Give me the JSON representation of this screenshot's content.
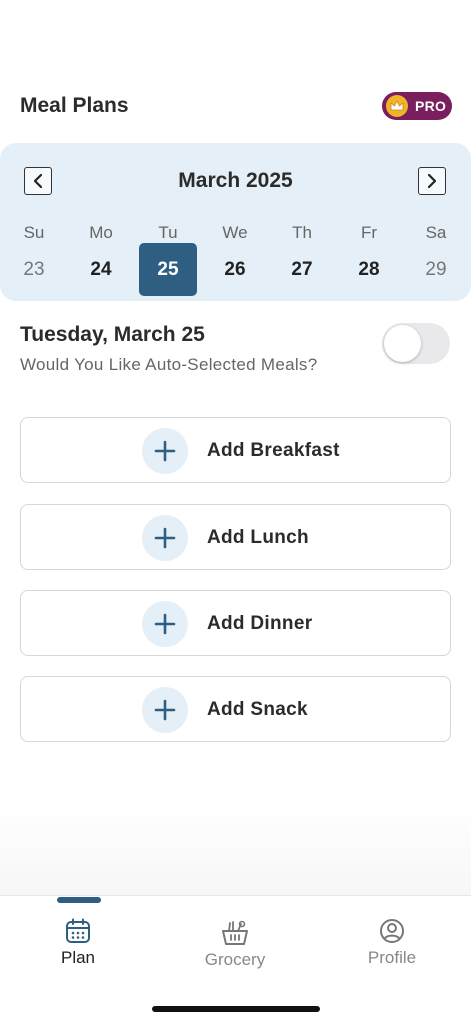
{
  "header": {
    "title": "Meal Plans",
    "pro_label": "PRO"
  },
  "calendar": {
    "month_label": "March 2025",
    "days": [
      {
        "dow": "Su",
        "num": "23"
      },
      {
        "dow": "Mo",
        "num": "24"
      },
      {
        "dow": "Tu",
        "num": "25"
      },
      {
        "dow": "We",
        "num": "26"
      },
      {
        "dow": "Th",
        "num": "27"
      },
      {
        "dow": "Fr",
        "num": "28"
      },
      {
        "dow": "Sa",
        "num": "29"
      }
    ],
    "selected_index": 2
  },
  "day_header": {
    "title": "Tuesday, March 25",
    "subtitle": "Would You Like Auto-Selected Meals?",
    "auto_select_enabled": false
  },
  "meals": [
    {
      "label": "Add Breakfast"
    },
    {
      "label": "Add Lunch"
    },
    {
      "label": "Add Dinner"
    },
    {
      "label": "Add Snack"
    }
  ],
  "tabs": [
    {
      "label": "Plan",
      "icon": "calendar-icon",
      "active": true
    },
    {
      "label": "Grocery",
      "icon": "basket-icon",
      "active": false
    },
    {
      "label": "Profile",
      "icon": "profile-icon",
      "active": false
    }
  ],
  "colors": {
    "accent": "#2e5f82",
    "calendar_bg": "#e5eff7",
    "pro_badge": "#7a1f5e",
    "crown": "#f0b429"
  }
}
